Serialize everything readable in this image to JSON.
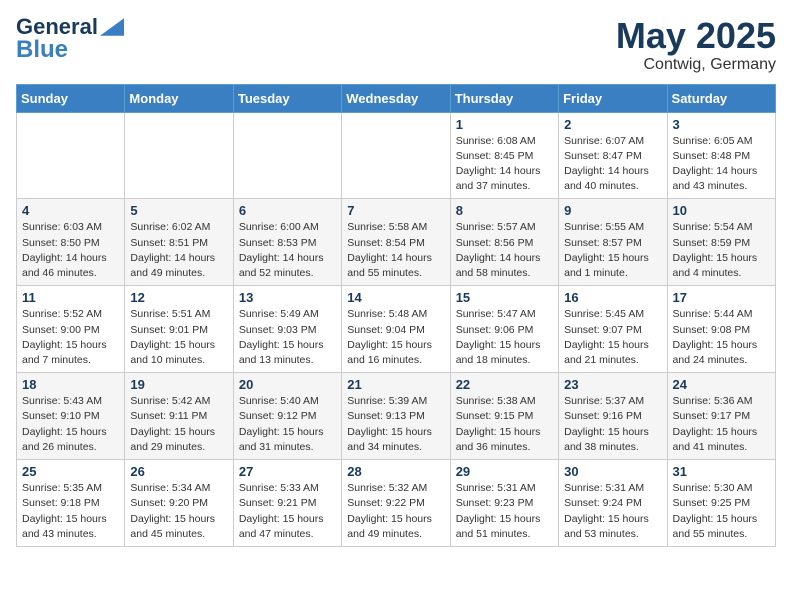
{
  "header": {
    "logo_line1": "General",
    "logo_line2": "Blue",
    "month": "May 2025",
    "location": "Contwig, Germany"
  },
  "days_of_week": [
    "Sunday",
    "Monday",
    "Tuesday",
    "Wednesday",
    "Thursday",
    "Friday",
    "Saturday"
  ],
  "weeks": [
    [
      {
        "day": "",
        "info": ""
      },
      {
        "day": "",
        "info": ""
      },
      {
        "day": "",
        "info": ""
      },
      {
        "day": "",
        "info": ""
      },
      {
        "day": "1",
        "info": "Sunrise: 6:08 AM\nSunset: 8:45 PM\nDaylight: 14 hours\nand 37 minutes."
      },
      {
        "day": "2",
        "info": "Sunrise: 6:07 AM\nSunset: 8:47 PM\nDaylight: 14 hours\nand 40 minutes."
      },
      {
        "day": "3",
        "info": "Sunrise: 6:05 AM\nSunset: 8:48 PM\nDaylight: 14 hours\nand 43 minutes."
      }
    ],
    [
      {
        "day": "4",
        "info": "Sunrise: 6:03 AM\nSunset: 8:50 PM\nDaylight: 14 hours\nand 46 minutes."
      },
      {
        "day": "5",
        "info": "Sunrise: 6:02 AM\nSunset: 8:51 PM\nDaylight: 14 hours\nand 49 minutes."
      },
      {
        "day": "6",
        "info": "Sunrise: 6:00 AM\nSunset: 8:53 PM\nDaylight: 14 hours\nand 52 minutes."
      },
      {
        "day": "7",
        "info": "Sunrise: 5:58 AM\nSunset: 8:54 PM\nDaylight: 14 hours\nand 55 minutes."
      },
      {
        "day": "8",
        "info": "Sunrise: 5:57 AM\nSunset: 8:56 PM\nDaylight: 14 hours\nand 58 minutes."
      },
      {
        "day": "9",
        "info": "Sunrise: 5:55 AM\nSunset: 8:57 PM\nDaylight: 15 hours\nand 1 minute."
      },
      {
        "day": "10",
        "info": "Sunrise: 5:54 AM\nSunset: 8:59 PM\nDaylight: 15 hours\nand 4 minutes."
      }
    ],
    [
      {
        "day": "11",
        "info": "Sunrise: 5:52 AM\nSunset: 9:00 PM\nDaylight: 15 hours\nand 7 minutes."
      },
      {
        "day": "12",
        "info": "Sunrise: 5:51 AM\nSunset: 9:01 PM\nDaylight: 15 hours\nand 10 minutes."
      },
      {
        "day": "13",
        "info": "Sunrise: 5:49 AM\nSunset: 9:03 PM\nDaylight: 15 hours\nand 13 minutes."
      },
      {
        "day": "14",
        "info": "Sunrise: 5:48 AM\nSunset: 9:04 PM\nDaylight: 15 hours\nand 16 minutes."
      },
      {
        "day": "15",
        "info": "Sunrise: 5:47 AM\nSunset: 9:06 PM\nDaylight: 15 hours\nand 18 minutes."
      },
      {
        "day": "16",
        "info": "Sunrise: 5:45 AM\nSunset: 9:07 PM\nDaylight: 15 hours\nand 21 minutes."
      },
      {
        "day": "17",
        "info": "Sunrise: 5:44 AM\nSunset: 9:08 PM\nDaylight: 15 hours\nand 24 minutes."
      }
    ],
    [
      {
        "day": "18",
        "info": "Sunrise: 5:43 AM\nSunset: 9:10 PM\nDaylight: 15 hours\nand 26 minutes."
      },
      {
        "day": "19",
        "info": "Sunrise: 5:42 AM\nSunset: 9:11 PM\nDaylight: 15 hours\nand 29 minutes."
      },
      {
        "day": "20",
        "info": "Sunrise: 5:40 AM\nSunset: 9:12 PM\nDaylight: 15 hours\nand 31 minutes."
      },
      {
        "day": "21",
        "info": "Sunrise: 5:39 AM\nSunset: 9:13 PM\nDaylight: 15 hours\nand 34 minutes."
      },
      {
        "day": "22",
        "info": "Sunrise: 5:38 AM\nSunset: 9:15 PM\nDaylight: 15 hours\nand 36 minutes."
      },
      {
        "day": "23",
        "info": "Sunrise: 5:37 AM\nSunset: 9:16 PM\nDaylight: 15 hours\nand 38 minutes."
      },
      {
        "day": "24",
        "info": "Sunrise: 5:36 AM\nSunset: 9:17 PM\nDaylight: 15 hours\nand 41 minutes."
      }
    ],
    [
      {
        "day": "25",
        "info": "Sunrise: 5:35 AM\nSunset: 9:18 PM\nDaylight: 15 hours\nand 43 minutes."
      },
      {
        "day": "26",
        "info": "Sunrise: 5:34 AM\nSunset: 9:20 PM\nDaylight: 15 hours\nand 45 minutes."
      },
      {
        "day": "27",
        "info": "Sunrise: 5:33 AM\nSunset: 9:21 PM\nDaylight: 15 hours\nand 47 minutes."
      },
      {
        "day": "28",
        "info": "Sunrise: 5:32 AM\nSunset: 9:22 PM\nDaylight: 15 hours\nand 49 minutes."
      },
      {
        "day": "29",
        "info": "Sunrise: 5:31 AM\nSunset: 9:23 PM\nDaylight: 15 hours\nand 51 minutes."
      },
      {
        "day": "30",
        "info": "Sunrise: 5:31 AM\nSunset: 9:24 PM\nDaylight: 15 hours\nand 53 minutes."
      },
      {
        "day": "31",
        "info": "Sunrise: 5:30 AM\nSunset: 9:25 PM\nDaylight: 15 hours\nand 55 minutes."
      }
    ]
  ]
}
